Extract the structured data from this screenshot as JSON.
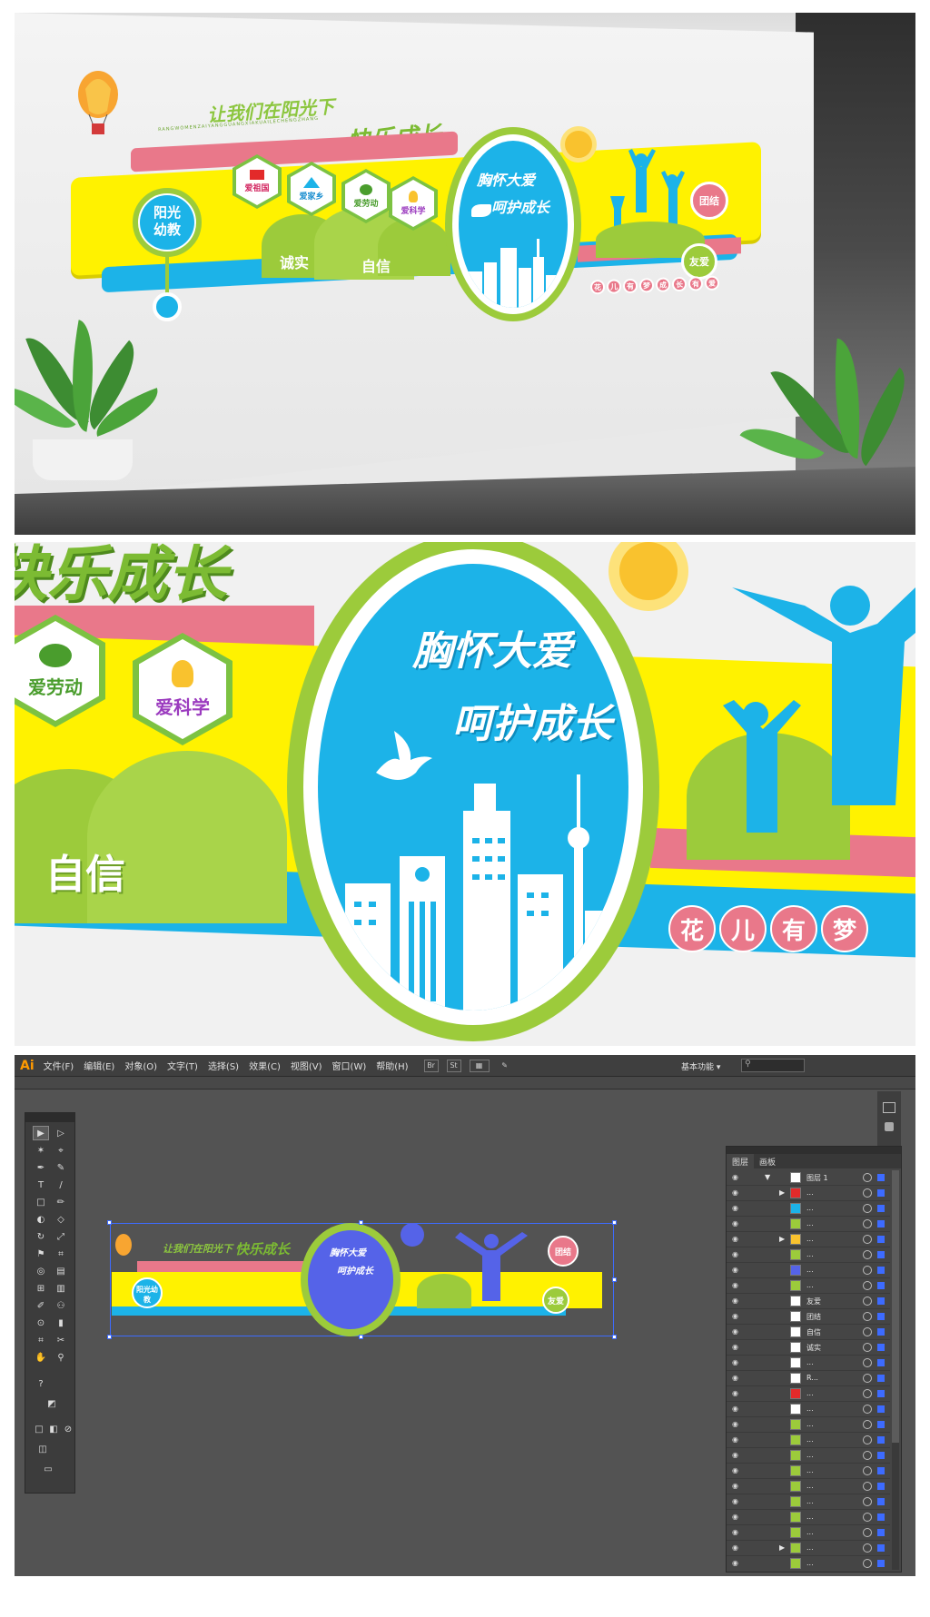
{
  "wall": {
    "banner_pinyin": "RANGWOMENZAIYANGGUANGXIAKUAILECHENGZHANG",
    "slogan_left": "让我们在阳光下",
    "slogan_right": "快乐成长",
    "logo_line1": "阳光",
    "logo_line2": "幼教",
    "hexagons": [
      "爱祖国",
      "爱家乡",
      "爱劳动",
      "爱科学"
    ],
    "values": [
      "诚实",
      "自信"
    ],
    "center_line1": "胸怀大爱",
    "center_line2": "呵护成长",
    "right_badges": [
      "团结",
      "友爱"
    ],
    "bottom_strip": [
      "花",
      "儿",
      "有",
      "梦",
      "成",
      "长",
      "有",
      "爱"
    ]
  },
  "detail": {
    "title_partial": "快乐成长",
    "hexagons": [
      "爱劳动",
      "爱科学"
    ],
    "value": "自信",
    "center_line1": "胸怀大爱",
    "center_line2": "呵护成长",
    "bottom_strip": [
      "花",
      "儿",
      "有",
      "梦"
    ]
  },
  "illustrator": {
    "app_logo": "Ai",
    "menu": [
      "文件(F)",
      "编辑(E)",
      "对象(O)",
      "文字(T)",
      "选择(S)",
      "效果(C)",
      "视图(V)",
      "窗口(W)",
      "帮助(H)"
    ],
    "menu_icons": [
      "Br",
      "St"
    ],
    "workspace": "基本功能",
    "panel_tabs": [
      "图层",
      "画板"
    ],
    "layer_top": "图层 1",
    "layers": [
      "...",
      "...",
      "...",
      "...",
      "...",
      "...",
      "...",
      "友爱",
      "团结",
      "自信",
      "诚实",
      "...",
      "R...",
      "...",
      "...",
      "...",
      "...",
      "...",
      "...",
      "...",
      "...",
      "...",
      "...",
      "...",
      "..."
    ],
    "artboard_text": {
      "slogan_left": "让我们在阳光下",
      "slogan_right": "快乐成长",
      "logo": "阳光幼教",
      "center_line1": "胸怀大爱",
      "center_line2": "呵护成长",
      "badge_1": "团结",
      "badge_2": "友爱"
    },
    "colors": {
      "ai_orange": "#ff9a00",
      "selection_blue": "#3d6bff"
    }
  },
  "colors": {
    "yellow": "#fff200",
    "cyan": "#1cb3e8",
    "green": "#9ccb3b",
    "pink": "#e56b7d",
    "white": "#ffffff"
  }
}
